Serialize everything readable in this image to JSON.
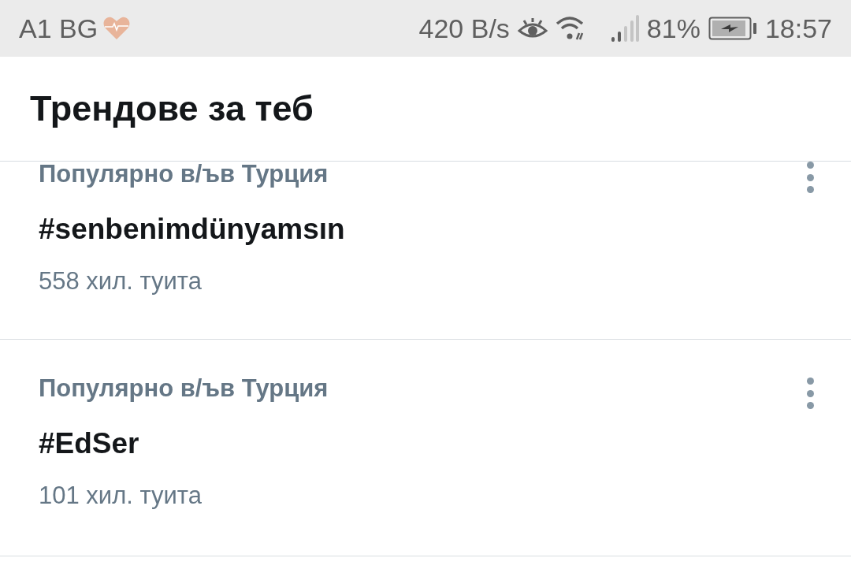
{
  "status_bar": {
    "carrier": "A1 BG",
    "speed": "420 B/s",
    "battery": "81%",
    "time": "18:57"
  },
  "header": {
    "title": "Трендове за теб"
  },
  "trends": [
    {
      "context": "Популярно в/ъв Турция",
      "name": "#senbenimdünyamsın",
      "count": "558 хил. туита"
    },
    {
      "context": "Популярно в/ъв Турция",
      "name": "#EdSer",
      "count": "101 хил. туита"
    }
  ]
}
